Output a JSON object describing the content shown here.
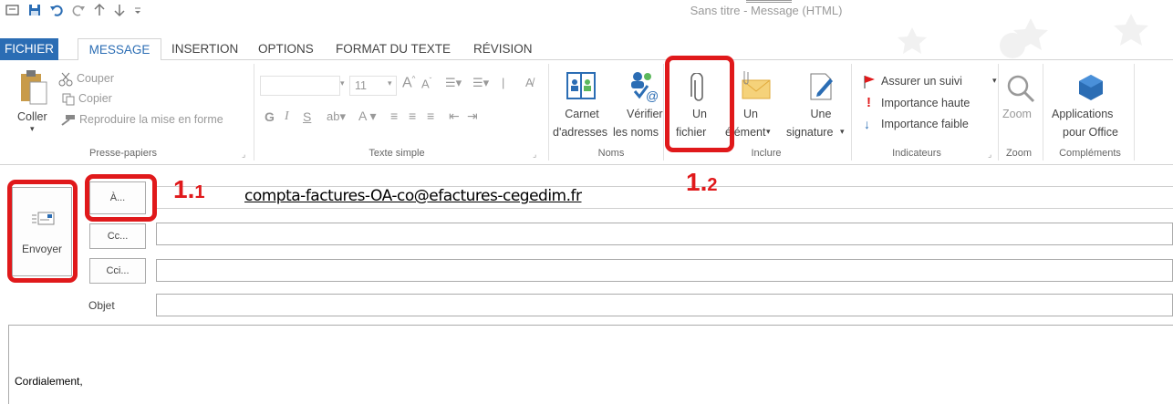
{
  "window": {
    "title": "Sans titre - Message (HTML)"
  },
  "tabs": {
    "file": "FICHIER",
    "message": "MESSAGE",
    "insertion": "INSERTION",
    "options": "OPTIONS",
    "format": "FORMAT DU TEXTE",
    "revision": "RÉVISION"
  },
  "clipboard": {
    "paste": "Coller",
    "cut": "Couper",
    "copy": "Copier",
    "format_painter": "Reproduire la mise en forme",
    "group_label": "Presse-papiers"
  },
  "basic_text": {
    "font_size": "11",
    "bold": "G",
    "italic": "I",
    "underline": "S",
    "group_label": "Texte simple"
  },
  "names": {
    "address_book_line1": "Carnet",
    "address_book_line2": "d'adresses",
    "check_names_line1": "Vérifier",
    "check_names_line2": "les noms",
    "group_label": "Noms"
  },
  "include": {
    "attach_file_line1": "Un",
    "attach_file_line2": "fichier",
    "attach_item_line1": "Un",
    "attach_item_line2": "élément",
    "signature_line1": "Une",
    "signature_line2": "signature",
    "group_label": "Inclure"
  },
  "tags": {
    "follow_up": "Assurer un suivi",
    "high_importance": "Importance haute",
    "low_importance": "Importance faible",
    "group_label": "Indicateurs"
  },
  "zoom": {
    "button": "Zoom",
    "group_label": "Zoom"
  },
  "addins": {
    "apps_line1": "Applications",
    "apps_line2": "pour Office",
    "group_label": "Compléments"
  },
  "compose": {
    "send": "Envoyer",
    "to_button": "À...",
    "cc_button": "Cc...",
    "bcc_button": "Cci...",
    "subject_label": "Objet",
    "to_value": "compta-factures-OA-co@efactures-cegedim.fr",
    "cc_value": "",
    "bcc_value": "",
    "subject_value": ""
  },
  "body": {
    "text": "Cordialement,"
  },
  "annotations": {
    "step_1_1_major": "1.",
    "step_1_1_minor": "1",
    "step_1_2_major": "1.",
    "step_1_2_minor": "2"
  },
  "colors": {
    "accent": "#2b6db4",
    "highlight": "#e0191b"
  }
}
